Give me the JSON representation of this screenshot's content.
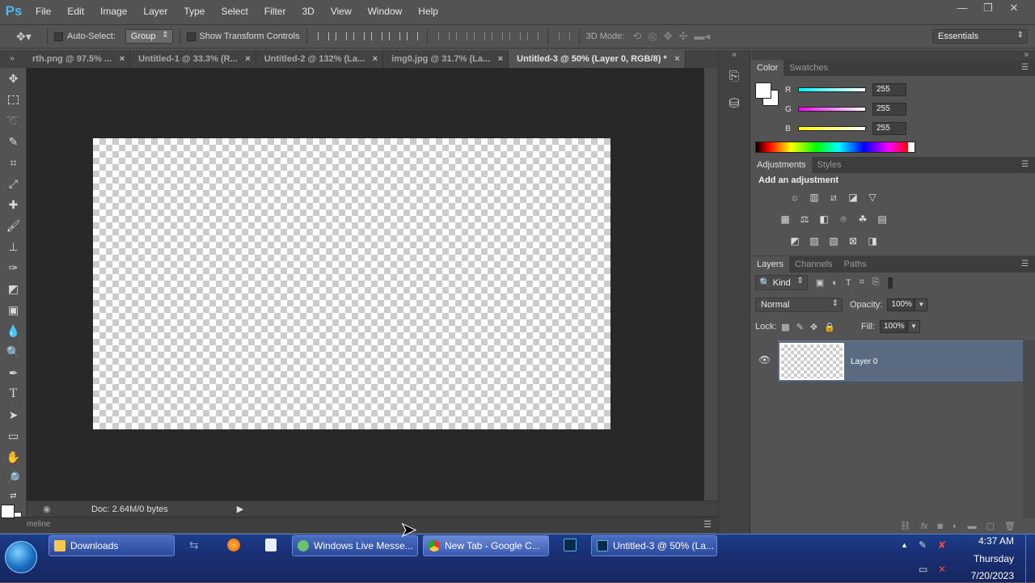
{
  "app": {
    "logo": "Ps"
  },
  "menu": [
    "File",
    "Edit",
    "Image",
    "Layer",
    "Type",
    "Select",
    "Filter",
    "3D",
    "View",
    "Window",
    "Help"
  ],
  "window_controls": [
    "—",
    "❐",
    "✕"
  ],
  "options": {
    "auto_select_label": "Auto-Select:",
    "auto_select_value": "Group",
    "show_transform_label": "Show Transform Controls",
    "mode_3d_label": "3D Mode:",
    "workspace": "Essentials"
  },
  "doc_tabs": [
    {
      "label": "rth.png @ 97.5% ..."
    },
    {
      "label": "Untitled-1 @ 33.3% (R..."
    },
    {
      "label": "Untitled-2 @ 132% (La..."
    },
    {
      "label": "img0.jpg @ 31.7% (La..."
    },
    {
      "label": "Untitled-3 @ 50% (Layer 0, RGB/8) *"
    }
  ],
  "status": {
    "doc_size": "Doc: 2.64M/0 bytes",
    "timeline": "meline"
  },
  "color_panel": {
    "tabs": [
      "Color",
      "Swatches"
    ],
    "channels": [
      {
        "label": "R",
        "value": "255",
        "color": "#00e5f0"
      },
      {
        "label": "G",
        "value": "255",
        "color": "#e93cd7"
      },
      {
        "label": "B",
        "value": "255",
        "color": "#f0ee1a"
      }
    ]
  },
  "adjustments_panel": {
    "tabs": [
      "Adjustments",
      "Styles"
    ],
    "title": "Add an adjustment"
  },
  "layers_panel": {
    "tabs": [
      "Layers",
      "Channels",
      "Paths"
    ],
    "filter_kind": "Kind",
    "blend_mode": "Normal",
    "opacity_label": "Opacity:",
    "opacity": "100%",
    "lock_label": "Lock:",
    "fill_label": "Fill:",
    "fill": "100%",
    "layers": [
      {
        "name": "Layer 0"
      }
    ]
  },
  "taskbar": {
    "buttons": [
      {
        "label": "Downloads"
      },
      {
        "label": "Windows Live Messe..."
      },
      {
        "label": "New Tab - Google C..."
      },
      {
        "label": "Untitled-3 @ 50% (La..."
      }
    ],
    "time": "4:37 AM",
    "day": "Thursday",
    "date": "7/20/2023"
  }
}
